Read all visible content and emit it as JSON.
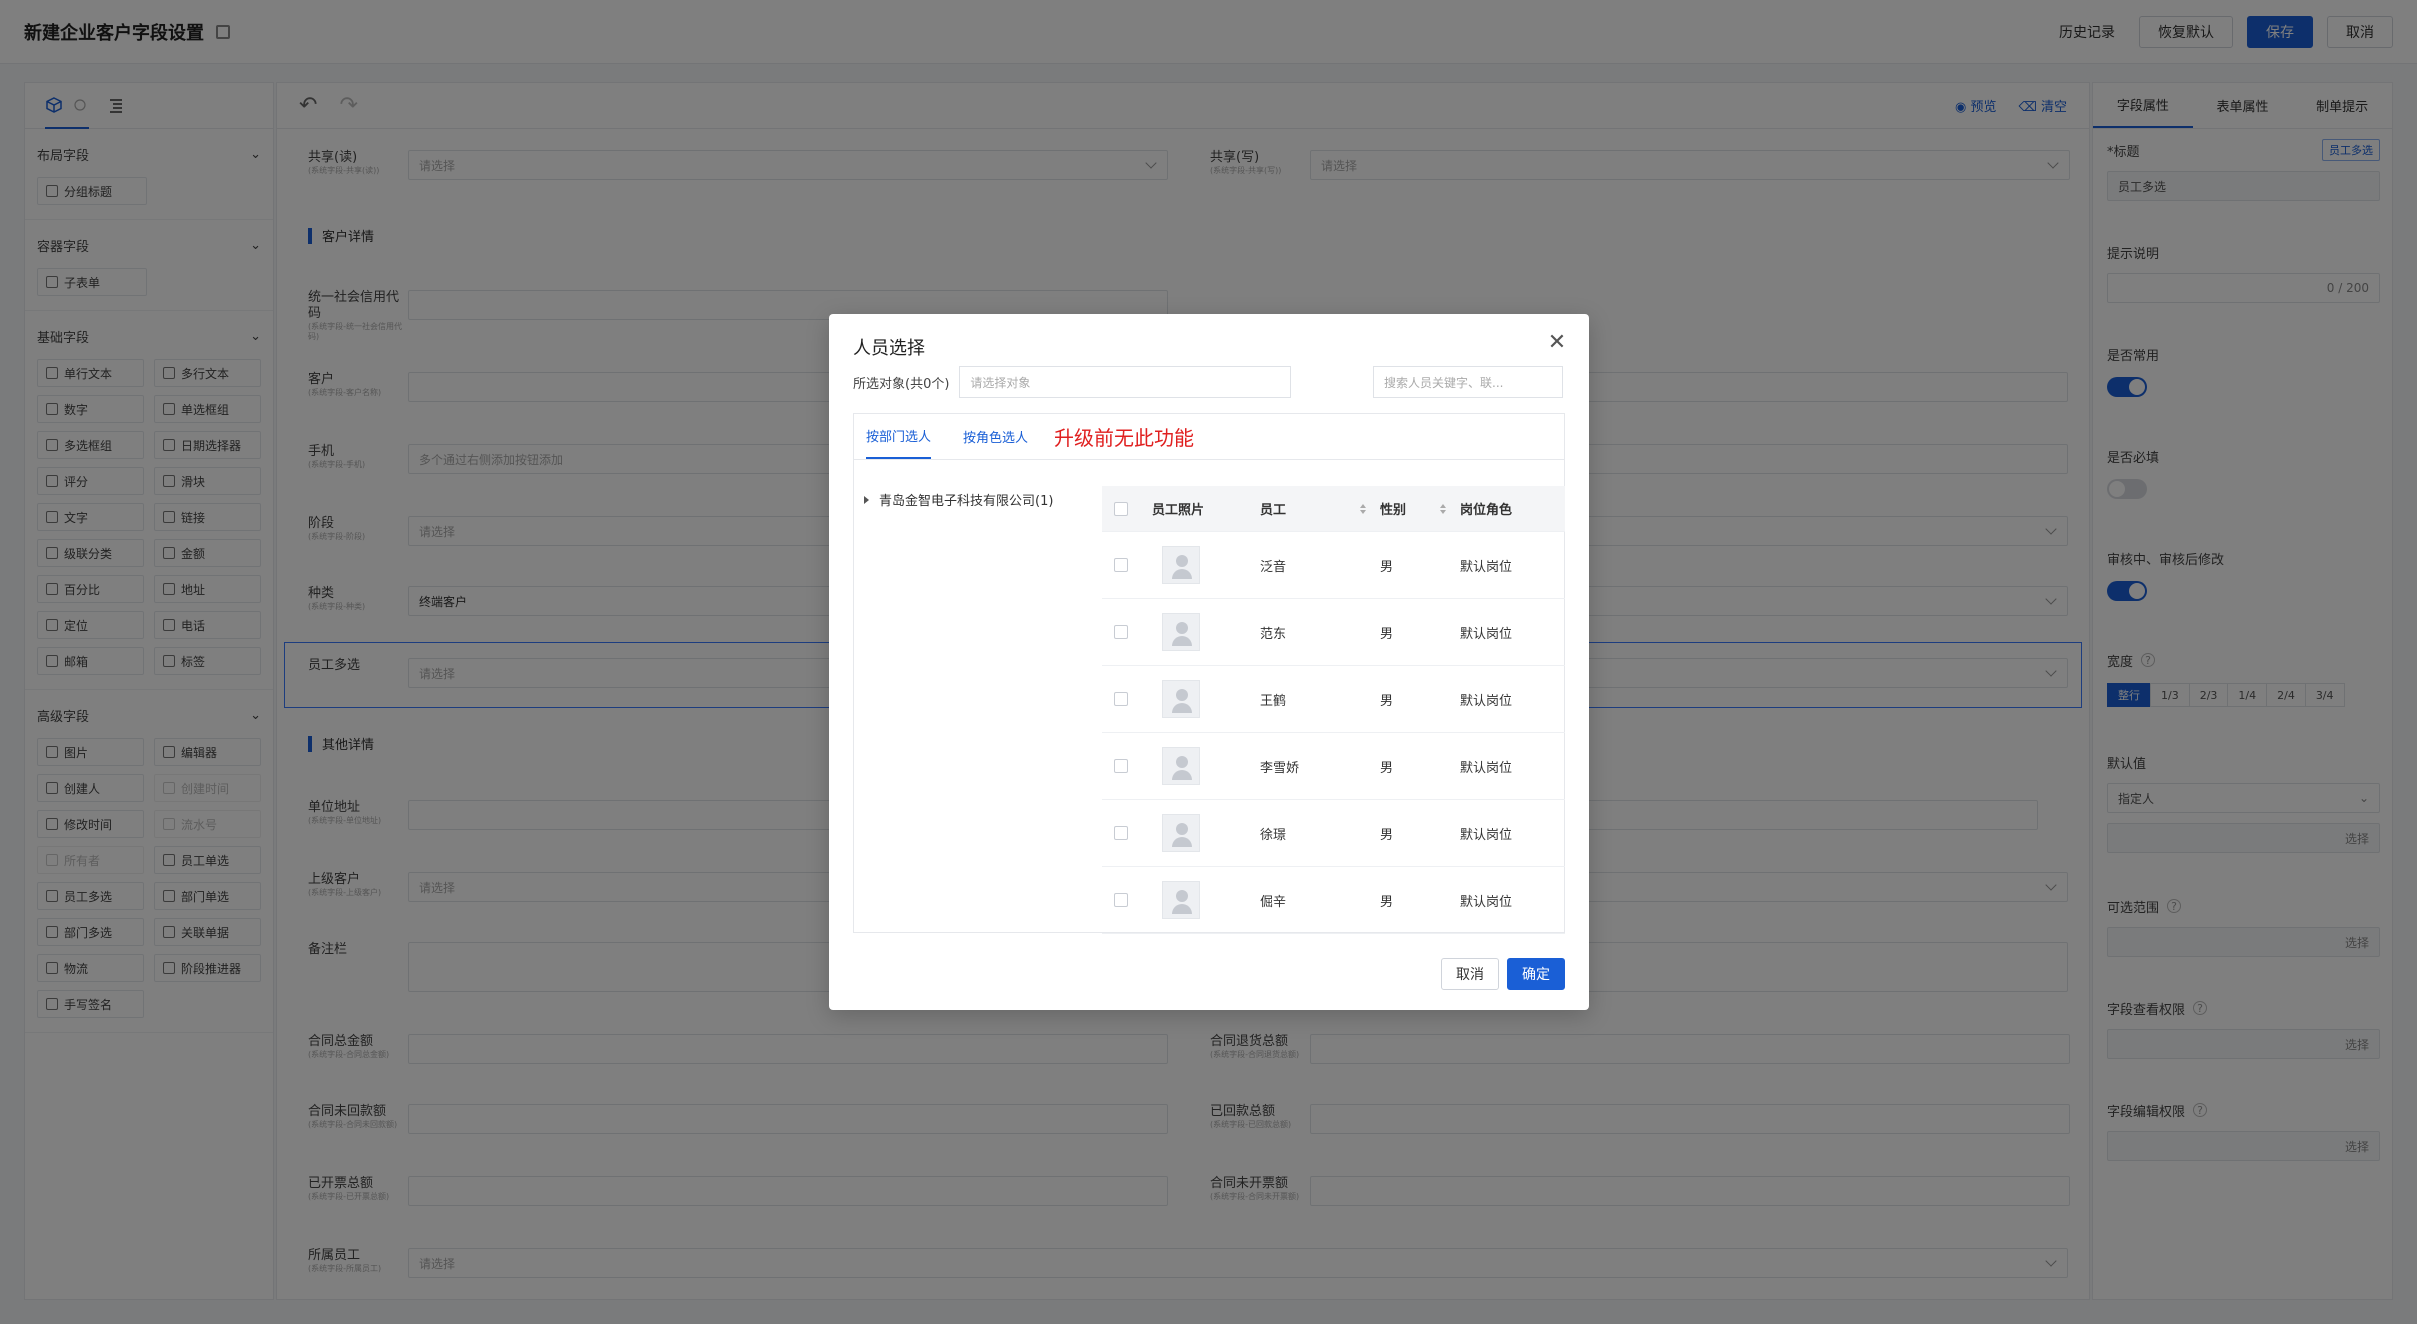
{
  "header": {
    "title": "新建企业客户字段设置",
    "history": "历史记录",
    "restore": "恢复默认",
    "save": "保存",
    "cancel": "取消"
  },
  "left_panel": {
    "groups": [
      {
        "title": "布局字段",
        "items": [
          {
            "label": "分组标题",
            "icon": "group-title-icon",
            "disabled": false
          }
        ]
      },
      {
        "title": "容器字段",
        "items": [
          {
            "label": "子表单",
            "icon": "table-icon",
            "disabled": false
          }
        ]
      },
      {
        "title": "基础字段",
        "items": [
          {
            "label": "单行文本",
            "icon": "single-text-icon",
            "disabled": false
          },
          {
            "label": "多行文本",
            "icon": "multi-text-icon",
            "disabled": false
          },
          {
            "label": "数字",
            "icon": "number-icon",
            "disabled": false
          },
          {
            "label": "单选框组",
            "icon": "radio-icon",
            "disabled": false
          },
          {
            "label": "多选框组",
            "icon": "checkbox-icon",
            "disabled": false
          },
          {
            "label": "日期选择器",
            "icon": "calendar-icon",
            "disabled": false
          },
          {
            "label": "评分",
            "icon": "star-icon",
            "disabled": false
          },
          {
            "label": "滑块",
            "icon": "slider-icon",
            "disabled": false
          },
          {
            "label": "文字",
            "icon": "text-icon",
            "disabled": false
          },
          {
            "label": "链接",
            "icon": "link-icon",
            "disabled": false
          },
          {
            "label": "级联分类",
            "icon": "cascade-icon",
            "disabled": false
          },
          {
            "label": "金额",
            "icon": "money-icon",
            "disabled": false
          },
          {
            "label": "百分比",
            "icon": "percent-icon",
            "disabled": false
          },
          {
            "label": "地址",
            "icon": "location-icon",
            "disabled": false
          },
          {
            "label": "定位",
            "icon": "position-icon",
            "disabled": false
          },
          {
            "label": "电话",
            "icon": "phone-icon",
            "disabled": false
          },
          {
            "label": "邮箱",
            "icon": "mail-icon",
            "disabled": false
          },
          {
            "label": "标签",
            "icon": "tag-icon",
            "disabled": false
          }
        ]
      },
      {
        "title": "高级字段",
        "items": [
          {
            "label": "图片",
            "icon": "image-icon",
            "disabled": false
          },
          {
            "label": "编辑器",
            "icon": "editor-icon",
            "disabled": false
          },
          {
            "label": "创建人",
            "icon": "user-icon",
            "disabled": false
          },
          {
            "label": "创建时间",
            "icon": "clock-icon",
            "disabled": true
          },
          {
            "label": "修改时间",
            "icon": "clock-icon",
            "disabled": false
          },
          {
            "label": "流水号",
            "icon": "serial-icon",
            "disabled": true
          },
          {
            "label": "所有者",
            "icon": "owner-icon",
            "disabled": true
          },
          {
            "label": "员工单选",
            "icon": "user-icon",
            "disabled": false
          },
          {
            "label": "员工多选",
            "icon": "users-icon",
            "disabled": false
          },
          {
            "label": "部门单选",
            "icon": "dept-icon",
            "disabled": false
          },
          {
            "label": "部门多选",
            "icon": "dept-icon",
            "disabled": false
          },
          {
            "label": "关联单据",
            "icon": "link-doc-icon",
            "disabled": false
          },
          {
            "label": "物流",
            "icon": "truck-icon",
            "disabled": false
          },
          {
            "label": "阶段推进器",
            "icon": "stage-icon",
            "disabled": false
          },
          {
            "label": "手写签名",
            "icon": "signature-icon",
            "disabled": false
          }
        ]
      }
    ]
  },
  "canvas": {
    "preview": "预览",
    "clear": "清空",
    "fields": {
      "share_read": {
        "label": "共享(读)",
        "hint": "(系统字段-共享(读))",
        "placeholder": "请选择"
      },
      "share_write": {
        "label": "共享(写)",
        "hint": "(系统字段-共享(写))",
        "placeholder": "请选择"
      },
      "section_customer": "客户详情",
      "credit_code": {
        "label": "统一社会信用代码",
        "hint": "(系统字段-统一社会信用代码)"
      },
      "customer": {
        "label": "客户",
        "hint": "(系统字段-客户名称)"
      },
      "mobile": {
        "label": "手机",
        "hint": "(系统字段-手机)",
        "placeholder": "多个通过右侧添加按钮添加"
      },
      "stage": {
        "label": "阶段",
        "hint": "(系统字段-阶段)",
        "placeholder": "请选择"
      },
      "kind": {
        "label": "种类",
        "hint": "(系统字段-种类)",
        "value": "终端客户"
      },
      "employee_multi": {
        "label": "员工多选",
        "placeholder": "请选择"
      },
      "section_other": "其他详情",
      "unit_address": {
        "label": "单位地址",
        "hint": "(系统字段-单位地址)"
      },
      "parent_customer": {
        "label": "上级客户",
        "hint": "(系统字段-上级客户)",
        "placeholder": "请选择"
      },
      "remark": {
        "label": "备注栏"
      },
      "contract_total": {
        "label": "合同总金额",
        "hint": "(系统字段-合同总金额)"
      },
      "contract_return": {
        "label": "合同退货总额",
        "hint": "(系统字段-合同退货总额)"
      },
      "contract_unreceived": {
        "label": "合同未回款额",
        "hint": "(系统字段-合同未回款额)"
      },
      "received_total": {
        "label": "已回款总额",
        "hint": "(系统字段-已回款总额)"
      },
      "invoiced_total": {
        "label": "已开票总额",
        "hint": "(系统字段-已开票总额)"
      },
      "uninvoiced": {
        "label": "合同未开票额",
        "hint": "(系统字段-合同未开票额)"
      },
      "owner_employee": {
        "label": "所属员工",
        "hint": "(系统字段-所属员工)",
        "placeholder": "请选择"
      }
    }
  },
  "right_panel": {
    "tabs": [
      "字段属性",
      "表单属性",
      "制单提示"
    ],
    "title_label": "*标题",
    "title_tag": "员工多选",
    "title_value": "员工多选",
    "hint_label": "提示说明",
    "hint_count": "0 / 200",
    "common_label": "是否常用",
    "required_label": "是否必填",
    "audit_label": "审核中、审核后修改",
    "width_label": "宽度",
    "width_options": [
      "整行",
      "1/3",
      "2/3",
      "1/4",
      "2/4",
      "3/4"
    ],
    "default_label": "默认值",
    "default_value": "指定人",
    "select": "选择",
    "range_label": "可选范围",
    "view_perm_label": "字段查看权限",
    "edit_perm_label": "字段编辑权限"
  },
  "modal": {
    "title": "人员选择",
    "selected_label": "所选对象(共0个)",
    "selected_placeholder": "请选择对象",
    "search_placeholder": "搜索人员关键字、联...",
    "tabs": [
      "按部门选人",
      "按角色选人"
    ],
    "note": "升级前无此功能",
    "tree_root": "青岛金智电子科技有限公司(1)",
    "columns": [
      "员工照片",
      "员工",
      "性别",
      "岗位角色"
    ],
    "rows": [
      {
        "name": "泛音",
        "sex": "男",
        "role": "默认岗位"
      },
      {
        "name": "范东",
        "sex": "男",
        "role": "默认岗位"
      },
      {
        "name": "王鹤",
        "sex": "男",
        "role": "默认岗位"
      },
      {
        "name": "李雪娇",
        "sex": "男",
        "role": "默认岗位"
      },
      {
        "name": "徐璟",
        "sex": "男",
        "role": "默认岗位"
      },
      {
        "name": "倔辛",
        "sex": "男",
        "role": "默认岗位"
      }
    ],
    "cancel": "取消",
    "confirm": "确定"
  }
}
